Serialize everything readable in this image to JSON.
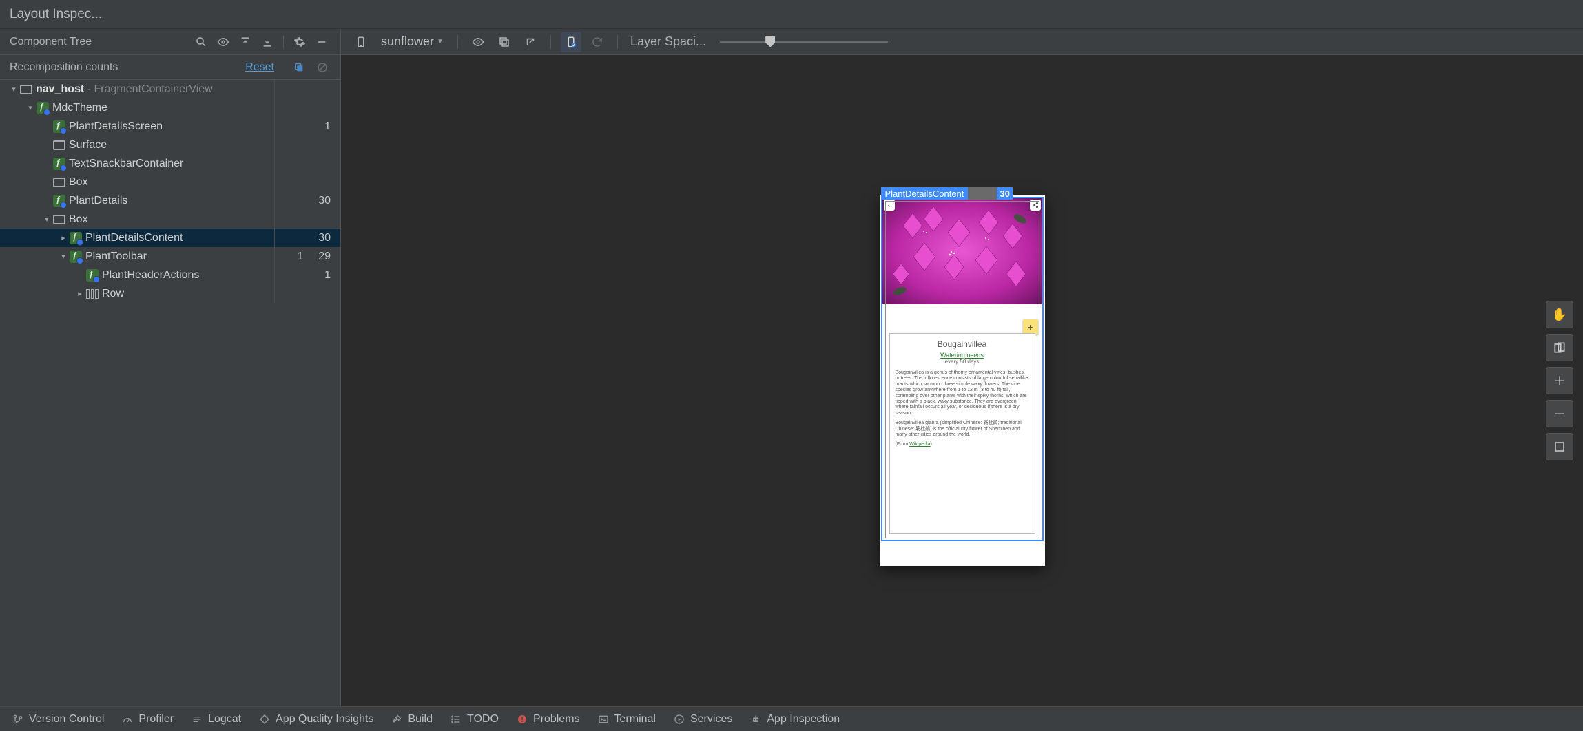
{
  "titlebar": {
    "title": "Layout Inspec..."
  },
  "left": {
    "header": "Component Tree",
    "recomp": {
      "label": "Recomposition counts",
      "reset": "Reset"
    },
    "tree": [
      {
        "depth": 0,
        "arrow": "▾",
        "iconType": "view",
        "bold": "nav_host",
        "secondary": " - FragmentContainerView",
        "c1": "",
        "c2": ""
      },
      {
        "depth": 1,
        "arrow": "▾",
        "iconType": "compose",
        "name": "MdcTheme",
        "c1": "",
        "c2": ""
      },
      {
        "depth": 2,
        "arrow": "",
        "iconType": "compose",
        "name": "PlantDetailsScreen",
        "c1": "1",
        "c2": ""
      },
      {
        "depth": 2,
        "arrow": "",
        "iconType": "view",
        "name": "Surface",
        "c1": "",
        "c2": ""
      },
      {
        "depth": 2,
        "arrow": "",
        "iconType": "compose",
        "name": "TextSnackbarContainer",
        "c1": "",
        "c2": ""
      },
      {
        "depth": 2,
        "arrow": "",
        "iconType": "view",
        "name": "Box",
        "c1": "",
        "c2": ""
      },
      {
        "depth": 2,
        "arrow": "",
        "iconType": "compose",
        "name": "PlantDetails",
        "c1": "30",
        "c2": ""
      },
      {
        "depth": 2,
        "arrow": "▾",
        "iconType": "view",
        "name": "Box",
        "c1": "",
        "c2": ""
      },
      {
        "depth": 3,
        "arrow": "▸",
        "iconType": "compose",
        "name": "PlantDetailsContent",
        "c1": "30",
        "c2": "",
        "selected": true,
        "guide": true
      },
      {
        "depth": 3,
        "arrow": "▾",
        "iconType": "compose",
        "name": "PlantToolbar",
        "c1": "1",
        "c2": "29",
        "guide": true
      },
      {
        "depth": 4,
        "arrow": "",
        "iconType": "compose",
        "name": "PlantHeaderActions",
        "c1": "",
        "c2": "1"
      },
      {
        "depth": 4,
        "arrow": "▸",
        "iconType": "row",
        "name": "Row",
        "c1": "",
        "c2": ""
      }
    ]
  },
  "right": {
    "device": "sunflower",
    "sliderLabel": "Layer Spaci...",
    "overlay": {
      "label": "PlantDetailsContent",
      "count": "30"
    },
    "preview": {
      "title": "Bougainvillea",
      "wateringLabel": "Watering needs",
      "wateringValue": "every 50 days",
      "para1": "Bougainvillea is a genus of thorny ornamental vines, bushes, or trees. The inflorescence consists of large colourful sepallike bracts which surround three simple waxy flowers. The vine species grow anywhere from 1 to 12 m (3 to 40 ft) tall, scrambling over other plants with their spiky thorns, which are tipped with a black, waxy substance. They are evergreen where rainfall occurs all year, or deciduous if there is a dry season.",
      "para2": "Bougainvillea glabra (simplified Chinese: 簕杜鹃; traditional Chinese: 簕杜鵑) is the official city flower of Shenzhen and many other cities around the world.",
      "fromLabel": "(From ",
      "fromLink": "Wikipedia",
      "fromEnd": ")"
    }
  },
  "bottom": {
    "items": [
      {
        "icon": "branch",
        "label": "Version Control"
      },
      {
        "icon": "gauge",
        "label": "Profiler"
      },
      {
        "icon": "logcat",
        "label": "Logcat"
      },
      {
        "icon": "diamond",
        "label": "App Quality Insights"
      },
      {
        "icon": "hammer",
        "label": "Build"
      },
      {
        "icon": "list",
        "label": "TODO"
      },
      {
        "icon": "err",
        "label": "Problems"
      },
      {
        "icon": "term",
        "label": "Terminal"
      },
      {
        "icon": "play",
        "label": "Services"
      },
      {
        "icon": "robot",
        "label": "App Inspection"
      }
    ]
  }
}
